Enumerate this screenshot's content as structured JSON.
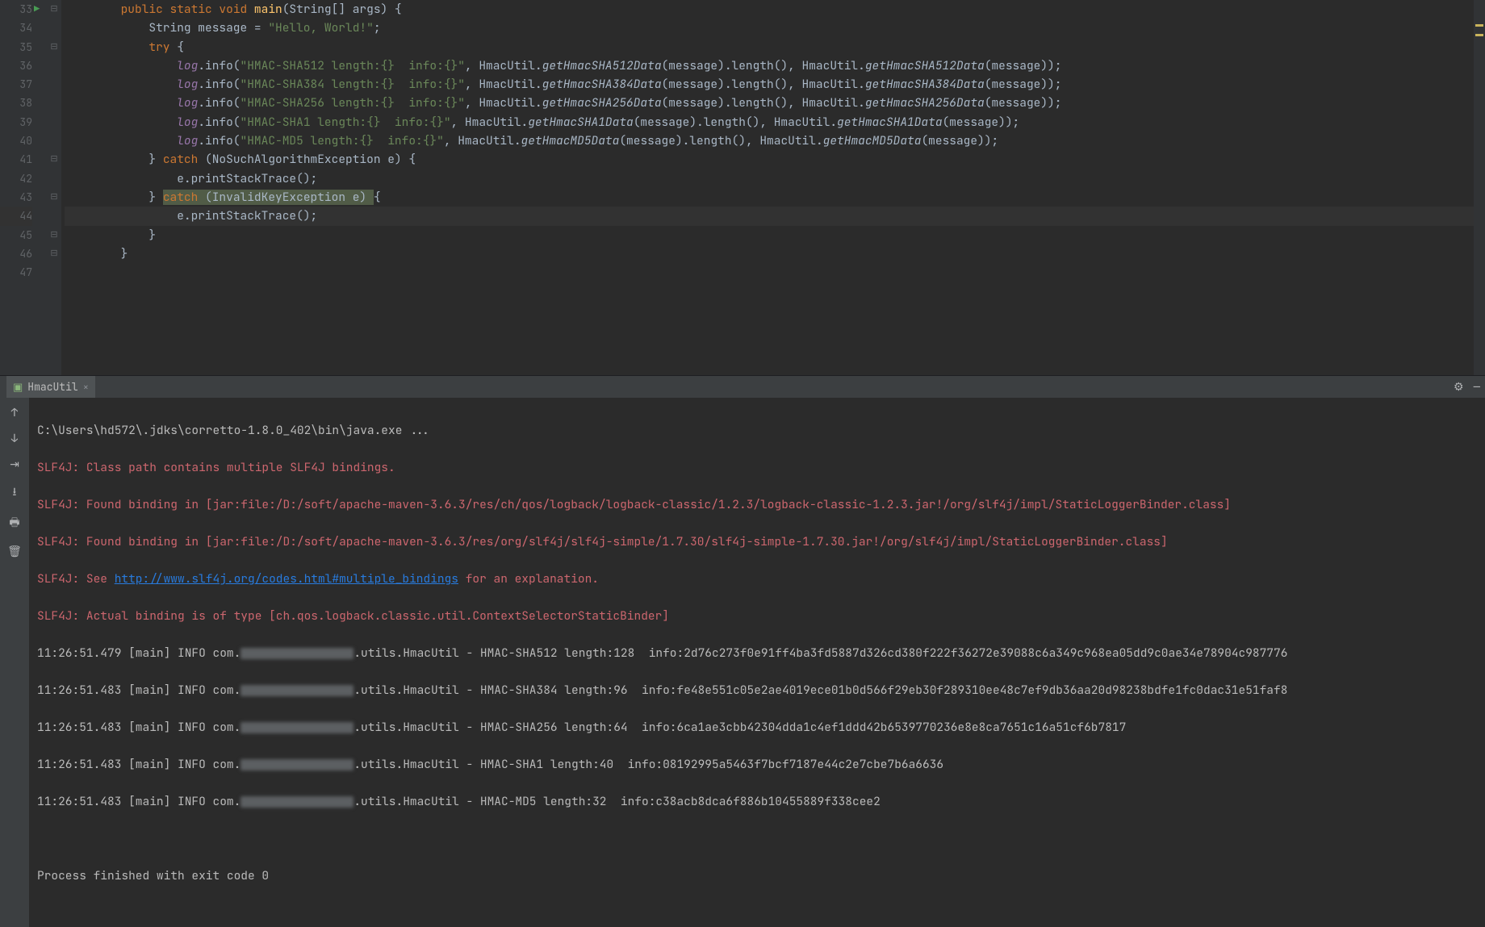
{
  "gutter": [
    "33",
    "34",
    "35",
    "36",
    "37",
    "38",
    "39",
    "40",
    "41",
    "42",
    "43",
    "44",
    "45",
    "46",
    "47"
  ],
  "fold": [
    "⊟",
    "",
    "⊟",
    "",
    "",
    "",
    "",
    "",
    "⊟",
    "",
    "⊟",
    "",
    "⊟",
    "⊟",
    ""
  ],
  "code": [
    [
      [
        "        ",
        ""
      ],
      [
        "public ",
        "kw"
      ],
      [
        "static ",
        "kw"
      ],
      [
        "void ",
        "kw"
      ],
      [
        "main",
        "mth"
      ],
      [
        "(String[] args) {",
        ""
      ]
    ],
    [
      [
        "            String message = ",
        ""
      ],
      [
        "\"Hello, World!\"",
        "str"
      ],
      [
        ";",
        ""
      ]
    ],
    [
      [
        "            ",
        ""
      ],
      [
        "try ",
        "kw"
      ],
      [
        "{",
        ""
      ]
    ],
    [
      [
        "                ",
        ""
      ],
      [
        "log",
        "sti"
      ],
      [
        ".info(",
        ""
      ],
      [
        "\"HMAC-SHA512 length:{}  info:{}\"",
        "str"
      ],
      [
        ", HmacUtil.",
        ""
      ],
      [
        "getHmacSHA512Data",
        "mcall"
      ],
      [
        "(message).length(), HmacUtil.",
        ""
      ],
      [
        "getHmacSHA512Data",
        "mcall"
      ],
      [
        "(message));",
        ""
      ]
    ],
    [
      [
        "                ",
        ""
      ],
      [
        "log",
        "sti"
      ],
      [
        ".info(",
        ""
      ],
      [
        "\"HMAC-SHA384 length:{}  info:{}\"",
        "str"
      ],
      [
        ", HmacUtil.",
        ""
      ],
      [
        "getHmacSHA384Data",
        "mcall"
      ],
      [
        "(message).length(), HmacUtil.",
        ""
      ],
      [
        "getHmacSHA384Data",
        "mcall"
      ],
      [
        "(message));",
        ""
      ]
    ],
    [
      [
        "                ",
        ""
      ],
      [
        "log",
        "sti"
      ],
      [
        ".info(",
        ""
      ],
      [
        "\"HMAC-SHA256 length:{}  info:{}\"",
        "str"
      ],
      [
        ", HmacUtil.",
        ""
      ],
      [
        "getHmacSHA256Data",
        "mcall"
      ],
      [
        "(message).length(), HmacUtil.",
        ""
      ],
      [
        "getHmacSHA256Data",
        "mcall"
      ],
      [
        "(message));",
        ""
      ]
    ],
    [
      [
        "                ",
        ""
      ],
      [
        "log",
        "sti"
      ],
      [
        ".info(",
        ""
      ],
      [
        "\"HMAC-SHA1 length:{}  info:{}\"",
        "str"
      ],
      [
        ", HmacUtil.",
        ""
      ],
      [
        "getHmacSHA1Data",
        "mcall"
      ],
      [
        "(message).length(), HmacUtil.",
        ""
      ],
      [
        "getHmacSHA1Data",
        "mcall"
      ],
      [
        "(message));",
        ""
      ]
    ],
    [
      [
        "                ",
        ""
      ],
      [
        "log",
        "sti"
      ],
      [
        ".info(",
        ""
      ],
      [
        "\"HMAC-MD5 length:{}  info:{}\"",
        "str"
      ],
      [
        ", HmacUtil.",
        ""
      ],
      [
        "getHmacMD5Data",
        "mcall"
      ],
      [
        "(message).length(), HmacUtil.",
        ""
      ],
      [
        "getHmacMD5Data",
        "mcall"
      ],
      [
        "(message));",
        ""
      ]
    ],
    [
      [
        "            } ",
        ""
      ],
      [
        "catch ",
        "kw"
      ],
      [
        "(NoSuchAlgorithmException e) {",
        ""
      ]
    ],
    [
      [
        "                e.printStackTrace();",
        ""
      ]
    ],
    [
      [
        "            } ",
        ""
      ],
      [
        "catch ",
        "kw hl"
      ],
      [
        "(InvalidKeyException e) ",
        "hl"
      ],
      [
        "{",
        ""
      ]
    ],
    [
      [
        "                e.printStackTrace();",
        ""
      ]
    ],
    [
      [
        "            }",
        ""
      ]
    ],
    [
      [
        "        }",
        ""
      ]
    ],
    [
      [
        "",
        ""
      ]
    ]
  ],
  "current_line_index": 11,
  "run": {
    "tab_label": "HmacUtil",
    "cmd": "C:\\Users\\hd572\\.jdks\\corretto-1.8.0_402\\bin\\java.exe ...",
    "err1": "SLF4J: Class path contains multiple SLF4J bindings.",
    "err2": "SLF4J: Found binding in [jar:file:/D:/soft/apache-maven-3.6.3/res/ch/qos/logback/logback-classic/1.2.3/logback-classic-1.2.3.jar!/org/slf4j/impl/StaticLoggerBinder.class]",
    "err3": "SLF4J: Found binding in [jar:file:/D:/soft/apache-maven-3.6.3/res/org/slf4j/slf4j-simple/1.7.30/slf4j-simple-1.7.30.jar!/org/slf4j/impl/StaticLoggerBinder.class]",
    "err4a": "SLF4J: See ",
    "err4link": "http://www.slf4j.org/codes.html#multiple_bindings",
    "err4b": " for an explanation.",
    "err5": "SLF4J: Actual binding is of type [ch.qos.logback.classic.util.ContextSelectorStaticBinder]",
    "l1a": "11:26:51.479 [main] INFO com.",
    "l1b": ".utils.HmacUtil - HMAC-SHA512 length:128  info:2d76c273f0e91ff4ba3fd5887d326cd380f222f36272e39088c6a349c968ea05dd9c0ae34e78904c987776",
    "l2a": "11:26:51.483 [main] INFO com.",
    "l2b": ".utils.HmacUtil - HMAC-SHA384 length:96  info:fe48e551c05e2ae4019ece01b0d566f29eb30f289310ee48c7ef9db36aa20d98238bdfe1fc0dac31e51faf8",
    "l3a": "11:26:51.483 [main] INFO com.",
    "l3b": ".utils.HmacUtil - HMAC-SHA256 length:64  info:6ca1ae3cbb42304dda1c4ef1ddd42b6539770236e8e8ca7651c16a51cf6b7817",
    "l4a": "11:26:51.483 [main] INFO com.",
    "l4b": ".utils.HmacUtil - HMAC-SHA1 length:40  info:08192995a5463f7bcf7187e44c2e7cbe7b6a6636",
    "l5a": "11:26:51.483 [main] INFO com.",
    "l5b": ".utils.HmacUtil - HMAC-MD5 length:32  info:c38acb8dca6f886b10455889f338cee2",
    "exit": "Process finished with exit code 0"
  },
  "icons": {
    "close": "×",
    "gear": "⚙",
    "minus": "—"
  }
}
